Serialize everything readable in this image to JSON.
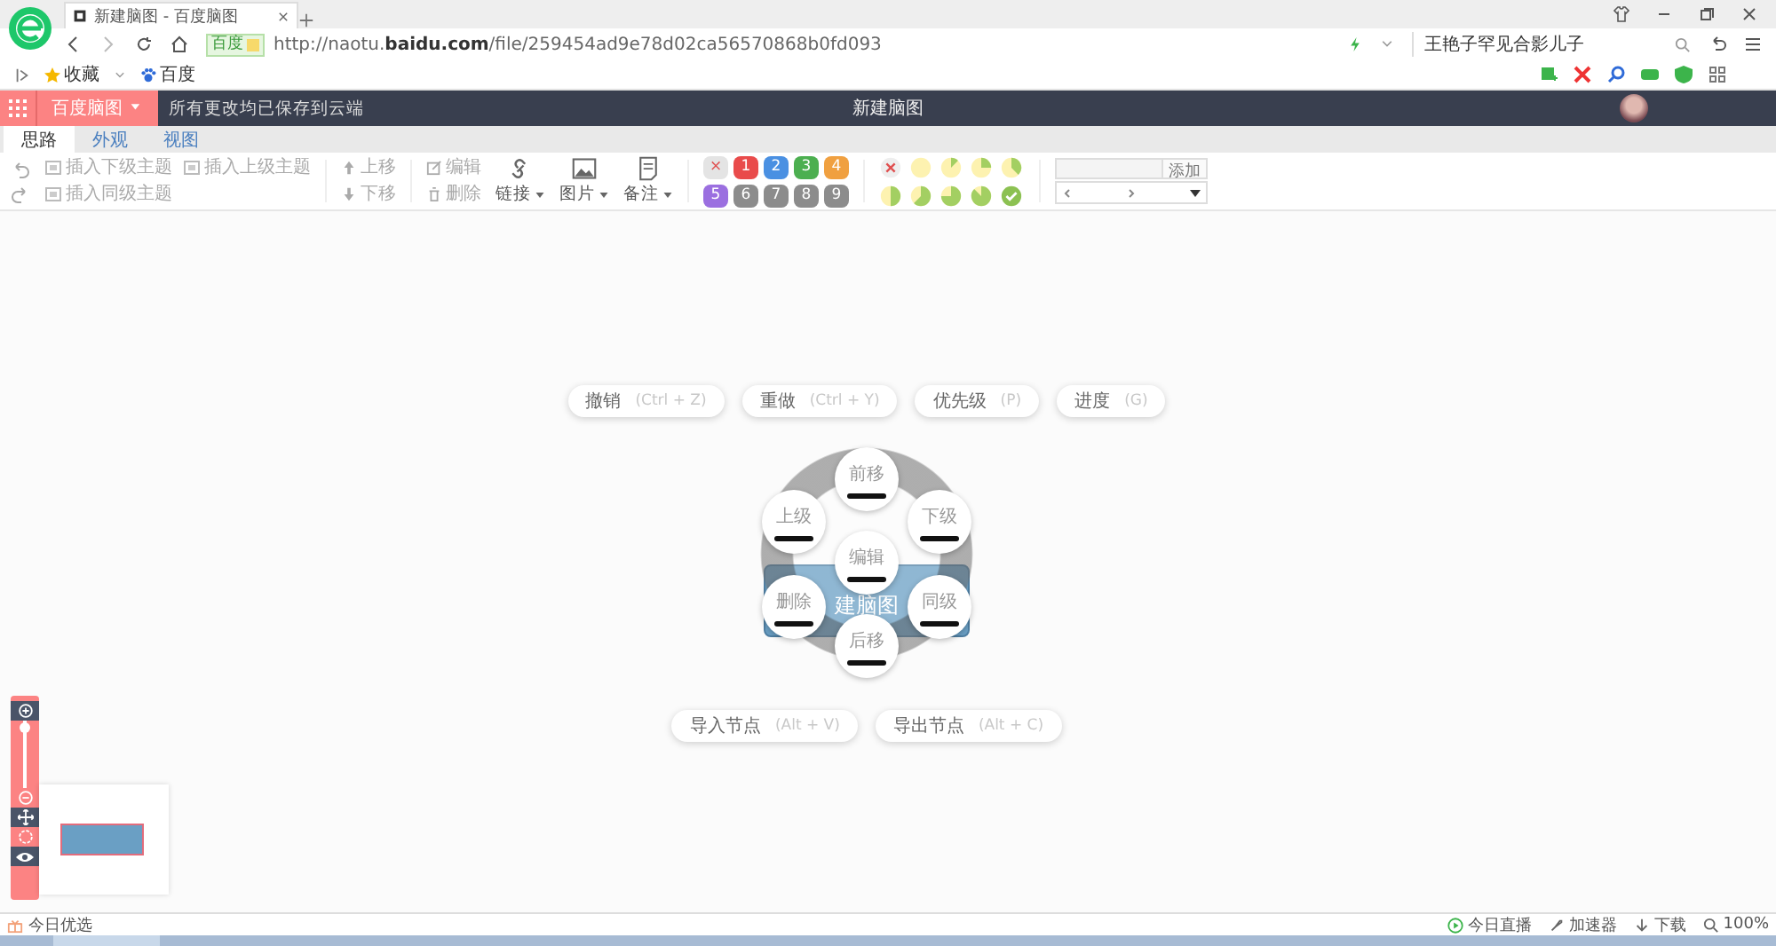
{
  "browser": {
    "tab": {
      "title": "新建脑图 - 百度脑图",
      "selected": true
    },
    "address": {
      "badge": "百度",
      "url_prefix": "http://naotu.",
      "url_domain": "baidu.com",
      "url_path": "/file/259454ad9e78d02ca56570868b0fd093"
    },
    "search": {
      "value": "王艳子罕见合影儿子"
    },
    "bookmarks": [
      {
        "label": "收藏"
      },
      {
        "label": "百度"
      }
    ]
  },
  "app": {
    "menu_button": "百度脑图",
    "save_status": "所有更改均已保存到云端",
    "title": "新建脑图"
  },
  "tabs": [
    {
      "label": "思路",
      "selected": true
    },
    {
      "label": "外观",
      "selected": false
    },
    {
      "label": "视图",
      "selected": false
    }
  ],
  "toolbar": {
    "insert": [
      {
        "label": "插入下级主题",
        "disabled": true
      },
      {
        "label": "插入上级主题",
        "disabled": true
      },
      {
        "label": "插入同级主题",
        "disabled": true
      }
    ],
    "move": [
      {
        "label": "上移",
        "disabled": true
      },
      {
        "label": "下移",
        "disabled": true
      }
    ],
    "edit": [
      {
        "label": "编辑",
        "disabled": true
      },
      {
        "label": "删除",
        "disabled": true
      }
    ],
    "menus": [
      {
        "label": "链接",
        "kind": "link"
      },
      {
        "label": "图片",
        "kind": "image"
      },
      {
        "label": "备注",
        "kind": "note"
      }
    ],
    "priorities": [
      {
        "label": "×",
        "color": "#e4e4e4"
      },
      {
        "label": "1",
        "color": "#e94b4b"
      },
      {
        "label": "2",
        "color": "#4a90e2"
      },
      {
        "label": "3",
        "color": "#4caf50"
      },
      {
        "label": "4",
        "color": "#f0a040"
      },
      {
        "label": "5",
        "color": "#9b6fe0"
      },
      {
        "label": "6",
        "color": "#8c8c8c"
      },
      {
        "label": "7",
        "color": "#8c8c8c"
      },
      {
        "label": "8",
        "color": "#8c8c8c"
      },
      {
        "label": "9",
        "color": "#8c8c8c"
      }
    ],
    "progress": [
      {
        "kind": "clear"
      },
      {
        "kind": "empty"
      },
      {
        "kind": "eighth"
      },
      {
        "kind": "quarter"
      },
      {
        "kind": "three-eighths"
      },
      {
        "kind": "half"
      },
      {
        "kind": "five-eighths"
      },
      {
        "kind": "three-quarters"
      },
      {
        "kind": "seven-eighths"
      },
      {
        "kind": "done"
      }
    ],
    "resource": {
      "button": "添加"
    }
  },
  "canvas": {
    "top_actions": [
      {
        "label": "撤销",
        "shortcut": "(Ctrl + Z)"
      },
      {
        "label": "重做",
        "shortcut": "(Ctrl + Y)"
      },
      {
        "label": "优先级",
        "shortcut": "(P)"
      },
      {
        "label": "进度",
        "shortcut": "(G)"
      }
    ],
    "node": {
      "text": "建脑图"
    },
    "ring": [
      {
        "label": "前移"
      },
      {
        "label": "上级"
      },
      {
        "label": "下级"
      },
      {
        "label": "编辑"
      },
      {
        "label": "删除"
      },
      {
        "label": "同级"
      },
      {
        "label": "后移"
      }
    ],
    "bottom_actions": [
      {
        "label": "导入节点",
        "shortcut": "(Alt + V)"
      },
      {
        "label": "导出节点",
        "shortcut": "(Alt + C)"
      }
    ],
    "zoom_slider": {
      "level": 0.95
    }
  },
  "status_bar": {
    "left": "今日优选",
    "right": [
      {
        "label": "今日直播",
        "kind": "live"
      },
      {
        "label": "加速器",
        "kind": "boost"
      },
      {
        "label": "下载",
        "kind": "download"
      },
      {
        "label": "100%",
        "kind": "zoom"
      }
    ]
  }
}
